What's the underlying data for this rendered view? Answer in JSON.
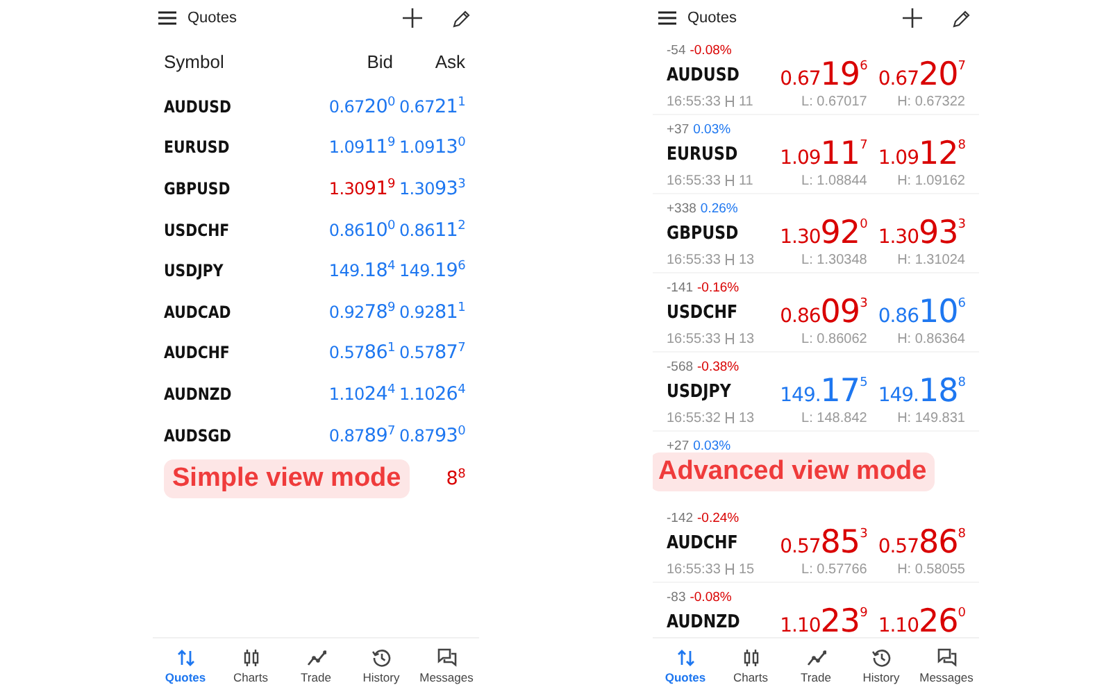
{
  "panels": [
    {
      "kind": "simple",
      "title": "Quotes",
      "columns": [
        "Symbol",
        "Bid",
        "Ask"
      ],
      "rows": [
        {
          "kind": "quote",
          "symbol": "AUDUSD",
          "bid": {
            "pre": "0.67",
            "big": "20",
            "sup": "0",
            "rising": true
          },
          "ask": {
            "pre": "0.67",
            "big": "21",
            "sup": "1",
            "rising": true
          }
        },
        {
          "kind": "quote",
          "symbol": "EURUSD",
          "bid": {
            "pre": "1.09",
            "big": "11",
            "sup": "9",
            "rising": true
          },
          "ask": {
            "pre": "1.09",
            "big": "13",
            "sup": "0",
            "rising": true
          }
        },
        {
          "kind": "quote",
          "symbol": "GBPUSD",
          "bid": {
            "pre": "1.30",
            "big": "91",
            "sup": "9",
            "rising": false
          },
          "ask": {
            "pre": "1.30",
            "big": "93",
            "sup": "3",
            "rising": true
          }
        },
        {
          "kind": "quote",
          "symbol": "USDCHF",
          "bid": {
            "pre": "0.86",
            "big": "10",
            "sup": "0",
            "rising": true
          },
          "ask": {
            "pre": "0.86",
            "big": "11",
            "sup": "2",
            "rising": true
          }
        },
        {
          "kind": "quote",
          "symbol": "USDJPY",
          "bid": {
            "pre": "149.",
            "big": "18",
            "sup": "4",
            "rising": true
          },
          "ask": {
            "pre": "149.",
            "big": "19",
            "sup": "6",
            "rising": true
          }
        },
        {
          "kind": "quote",
          "symbol": "AUDCAD",
          "bid": {
            "pre": "0.92",
            "big": "78",
            "sup": "9",
            "rising": true
          },
          "ask": {
            "pre": "0.92",
            "big": "81",
            "sup": "1",
            "rising": true
          }
        },
        {
          "kind": "quote",
          "symbol": "AUDCHF",
          "bid": {
            "pre": "0.57",
            "big": "86",
            "sup": "1",
            "rising": true
          },
          "ask": {
            "pre": "0.57",
            "big": "87",
            "sup": "7",
            "rising": true
          }
        },
        {
          "kind": "quote",
          "symbol": "AUDNZD",
          "bid": {
            "pre": "1.10",
            "big": "24",
            "sup": "4",
            "rising": true
          },
          "ask": {
            "pre": "1.10",
            "big": "26",
            "sup": "4",
            "rising": true
          }
        },
        {
          "kind": "quote",
          "symbol": "AUDSGD",
          "bid": {
            "pre": "0.87",
            "big": "89",
            "sup": "7",
            "rising": true
          },
          "ask": {
            "pre": "0.87",
            "big": "93",
            "sup": "0",
            "rising": true
          }
        },
        {
          "kind": "covered",
          "ask": {
            "big": "8",
            "sup": "8",
            "rising": false
          }
        }
      ],
      "badge": "Simple view mode",
      "nav": [
        {
          "label": "Quotes",
          "selected": true
        },
        {
          "label": "Charts",
          "selected": false
        },
        {
          "label": "Trade",
          "selected": false
        },
        {
          "label": "History",
          "selected": false
        },
        {
          "label": "Messages",
          "selected": false
        }
      ]
    },
    {
      "kind": "advanced",
      "title": "Quotes",
      "rows": [
        {
          "kind": "quote",
          "points": "-54",
          "percent": "-0.08%",
          "change_rising": false,
          "symbol": "AUDUSD",
          "time": "16:55:33",
          "spread": "11",
          "bid": {
            "pre": "0.67",
            "big": "19",
            "sup": "6",
            "rising": false
          },
          "ask": {
            "pre": "0.67",
            "big": "20",
            "sup": "7",
            "rising": false
          },
          "low": "L: 0.67017",
          "high": "H: 0.67322"
        },
        {
          "kind": "quote",
          "points": "+37",
          "percent": "0.03%",
          "change_rising": true,
          "symbol": "EURUSD",
          "time": "16:55:33",
          "spread": "11",
          "bid": {
            "pre": "1.09",
            "big": "11",
            "sup": "7",
            "rising": false
          },
          "ask": {
            "pre": "1.09",
            "big": "12",
            "sup": "8",
            "rising": false
          },
          "low": "L: 1.08844",
          "high": "H: 1.09162"
        },
        {
          "kind": "quote",
          "points": "+338",
          "percent": "0.26%",
          "change_rising": true,
          "symbol": "GBPUSD",
          "time": "16:55:33",
          "spread": "13",
          "bid": {
            "pre": "1.30",
            "big": "92",
            "sup": "0",
            "rising": false
          },
          "ask": {
            "pre": "1.30",
            "big": "93",
            "sup": "3",
            "rising": false
          },
          "low": "L: 1.30348",
          "high": "H: 1.31024"
        },
        {
          "kind": "quote",
          "points": "-141",
          "percent": "-0.16%",
          "change_rising": false,
          "symbol": "USDCHF",
          "time": "16:55:33",
          "spread": "13",
          "bid": {
            "pre": "0.86",
            "big": "09",
            "sup": "3",
            "rising": false
          },
          "ask": {
            "pre": "0.86",
            "big": "10",
            "sup": "6",
            "rising": true
          },
          "low": "L: 0.86062",
          "high": "H: 0.86364"
        },
        {
          "kind": "quote",
          "points": "-568",
          "percent": "-0.38%",
          "change_rising": false,
          "symbol": "USDJPY",
          "time": "16:55:32",
          "spread": "13",
          "bid": {
            "pre": "149.",
            "big": "17",
            "sup": "5",
            "rising": true
          },
          "ask": {
            "pre": "149.",
            "big": "18",
            "sup": "8",
            "rising": true
          },
          "low": "L: 148.842",
          "high": "H: 149.831"
        },
        {
          "kind": "covered",
          "points": "+27",
          "percent": "0.03%",
          "change_rising": true
        },
        {
          "kind": "quote",
          "points": "-142",
          "percent": "-0.24%",
          "change_rising": false,
          "symbol": "AUDCHF",
          "time": "16:55:33",
          "spread": "15",
          "bid": {
            "pre": "0.57",
            "big": "85",
            "sup": "3",
            "rising": false
          },
          "ask": {
            "pre": "0.57",
            "big": "86",
            "sup": "8",
            "rising": false
          },
          "low": "L: 0.57766",
          "high": "H: 0.58055"
        },
        {
          "kind": "quote",
          "points": "-83",
          "percent": "-0.08%",
          "change_rising": false,
          "symbol": "AUDNZD",
          "bid": {
            "pre": "1.10",
            "big": "23",
            "sup": "9",
            "rising": false
          },
          "ask": {
            "pre": "1.10",
            "big": "26",
            "sup": "0",
            "rising": false
          }
        }
      ],
      "badge": "Advanced view mode",
      "nav": [
        {
          "label": "Quotes",
          "selected": true
        },
        {
          "label": "Charts",
          "selected": false
        },
        {
          "label": "Trade",
          "selected": false
        },
        {
          "label": "History",
          "selected": false
        },
        {
          "label": "Messages",
          "selected": false
        }
      ]
    }
  ]
}
